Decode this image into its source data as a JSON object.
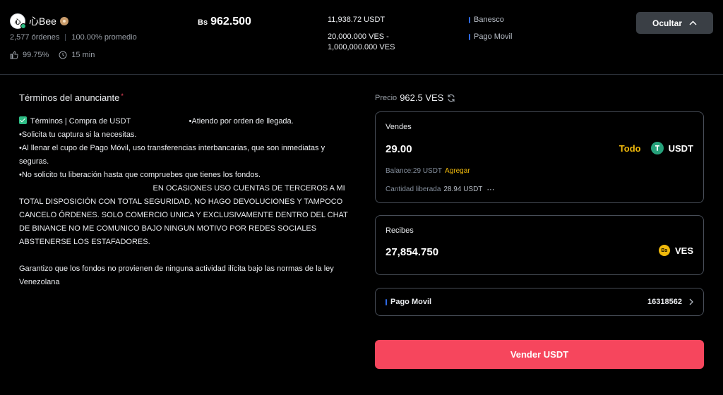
{
  "advertiser": {
    "name": "心Bee",
    "orders": "2,577 órdenes",
    "completion": "100.00% promedio",
    "positive_rate": "99.75%",
    "release_time": "15 min"
  },
  "ad": {
    "currency_symbol": "Bs",
    "price": "962.500",
    "available": "11,938.72 USDT",
    "limit_range": "20,000.000 VES - 1,000,000.000 VES",
    "payment_methods": [
      "Banesco",
      "Pago Movil"
    ],
    "hide_label": "Ocultar"
  },
  "terms": {
    "title": "Términos del anunciante",
    "required_mark": "*",
    "first_line": "Términos | Compra de USDT                           •Atiendo por orden de llegada.",
    "body": "•Solicita tu captura si la necesitas.\n•Al llenar el cupo de Pago Móvil, uso transferencias interbancarias, que son inmediatas y seguras.\n•No solicito tu liberación hasta que compruebes que tienes los fondos.\n                                                              EN OCASIONES USO CUENTAS DE TERCEROS A MI TOTAL DISPOSICIÓN CON TOTAL SEGURIDAD, NO HAGO DEVOLUCIONES Y TAMPOCO CANCELO ÓRDENES. SOLO COMERCIO UNICA Y EXCLUSIVAMENTE DENTRO DEL CHAT DE BINANCE NO ME COMUNICO BAJO NINGUN MOTIVO POR REDES SOCIALES ABSTENERSE LOS ESTAFADORES.\n\nGarantizo que los fondos no provienen de ninguna actividad ilícita bajo las normas de la ley Venezolana"
  },
  "order": {
    "rate_label": "Precio",
    "rate_value": "962.5 VES",
    "sell": {
      "label": "Vendes",
      "amount": "29.00",
      "all_label": "Todo",
      "asset": "USDT",
      "balance": "Balance:29 USDT",
      "add_label": "Agregar",
      "released_label": "Cantidad liberada",
      "released_value": "28.94 USDT",
      "more": "⋯"
    },
    "receive": {
      "label": "Recibes",
      "amount": "27,854.750",
      "asset": "VES",
      "coin_glyph": "Bs"
    },
    "payment": {
      "method": "Pago Movil",
      "account": "16318562"
    },
    "submit_label": "Vender USDT"
  },
  "colors": {
    "accent": "#f0b90b",
    "sell_button": "#f6465d",
    "payment_bar": "#2e6ae6"
  }
}
